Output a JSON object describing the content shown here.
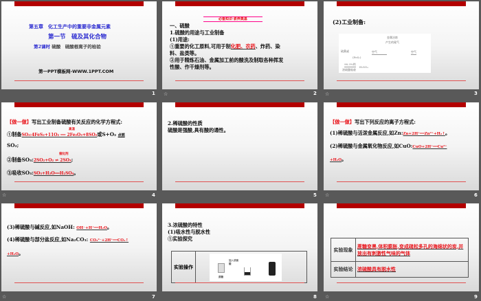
{
  "slides": [
    {
      "number": "1",
      "chapter": "第五章　化工生产中的重要非金属元素",
      "section": "第一节　硫及其化合物",
      "lesson_label": "第2课时",
      "lesson_title": "硫酸　硫酸根离子的检验",
      "site": "第一PPT模板网-WWW.1PPT.COM"
    },
    {
      "number": "2",
      "banner": "必备知识·素养奠基",
      "h1": "一、硫酸",
      "h2": "1.硫酸的用途与工业制备",
      "h3": "(1)用途:",
      "p1a": "①重要的化工原料,可用于制",
      "p1ans": "化肥、农药",
      "p1b": "、炸药、染",
      "p1c": "料、盐类等。",
      "p2a": "②用于精炼石油、金属加工前的酸洗及制取各种挥发",
      "p2b": "性酸、作干燥剂等。"
    },
    {
      "number": "3",
      "h": "(2)工业制备:",
      "d1": "金属冶炼",
      "d2": "产生的尾气",
      "d3": "硫黄或",
      "d4": "(FeS₂)",
      "d5": "空气",
      "d6": "空气",
      "d7": "98.3%的",
      "d8": "浓硫酸吸收",
      "d9": "H₂SO₄"
    },
    {
      "number": "4",
      "tag": "【做一做】",
      "q": "写出工业制备硫酸有关反应的化学方程式:",
      "l1a": "①制备",
      "l1ans": "SO₂:4FeS₂+11O₂ ══ 2Fe₂O₃+8SO₂",
      "l1cond": "高温",
      "l1b": "或S+O₂",
      "l1cond2": "点燃",
      "l1c": "SO₂;",
      "l2a": "②制备SO₃:",
      "l2ans": "2SO₂+O₂ ⇌ 2SO₃",
      "l2cond": "催化剂",
      "l2b": ";",
      "l3a": "③吸收SO₃:",
      "l3ans": "SO₃+H₂O══H₂SO₄",
      "l3b": "。"
    },
    {
      "number": "5",
      "h": "2.稀硫酸的性质",
      "p": "硫酸是强酸,具有酸的通性。"
    },
    {
      "number": "6",
      "tag": "【做一做】",
      "q": "写出下列反应的离子方程式:",
      "l1a": "(1)稀硫酸与活泼金属反应,如Zn:",
      "l1ans": "Zn+2H⁺══Zn²⁺+H₂↑",
      "l1b": "。",
      "l2a": "(2)稀硫酸与金属氧化物反应,如CuO:",
      "l2ans": "CuO+2H⁺══Cu²⁺",
      "l2ans2": "+H₂O",
      "l2b": "。"
    },
    {
      "number": "7",
      "l1a": "(3)稀硫酸与碱反应,如NaOH:",
      "l1ans": "OH⁻+H⁺══H₂O",
      "l1b": "。",
      "l2a": "(4)稀硫酸与部分盐反应,如Na₂CO₃:",
      "l2ans": "CO₃²⁻+2H⁺══CO₂↑",
      "l2ans2": "+H₂O",
      "l2b": "。"
    },
    {
      "number": "8",
      "h1": "3.浓硫酸的特性",
      "h2": "(1)吸水性与脱水性",
      "h3": "①实验探究",
      "row_label": "实验操作",
      "img_label1": "加入浓硫酸",
      "img_label2": "蔗糖"
    },
    {
      "number": "9",
      "row1_label": "实验现象",
      "row1_value": "蔗糖变黑,体积膨胀,变成疏松多孔的海绵状的炭,并放出有刺激性气味的气体",
      "row2_label": "实验结论",
      "row2_value": "浓硫酸具有脱水性"
    }
  ],
  "transition_icon": "☆"
}
